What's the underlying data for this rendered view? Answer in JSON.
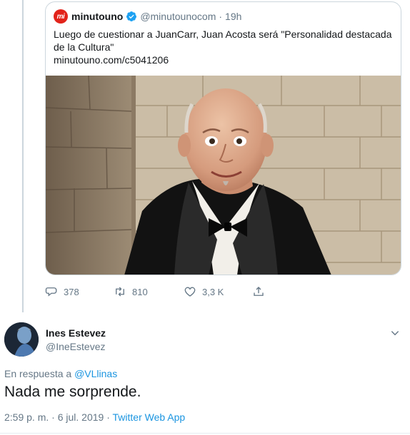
{
  "quote": {
    "account_name": "minutouno",
    "logo_text": "mi",
    "handle": "@minutounocom",
    "separator": "·",
    "time": "19h",
    "text_line1": "Luego de cuestionar a JuanCarr, Juan Acosta será \"Personalidad destacada",
    "text_line2": "de la Cultura\"",
    "link": "minutouno.com/c5041206",
    "image_icon": "photo-of-man-in-tuxedo"
  },
  "actions": {
    "replies": "378",
    "retweets": "810",
    "likes": "3,3 K",
    "icons": [
      "reply-icon",
      "retweet-icon",
      "like-icon",
      "share-icon"
    ]
  },
  "reply": {
    "name": "Ines Estevez",
    "handle": "@IneEstevez",
    "in_reply_prefix": "En respuesta a",
    "in_reply_mention": "@VLlinas",
    "text": "Nada me sorprende.",
    "timestamp": "2:59 p. m. · 6 jul. 2019 ·",
    "source": "Twitter Web App"
  },
  "colors": {
    "link_blue": "#1b95e0",
    "muted_gray": "#657786",
    "verified_blue": "#1da1f2",
    "brand_red": "#e2231a"
  }
}
